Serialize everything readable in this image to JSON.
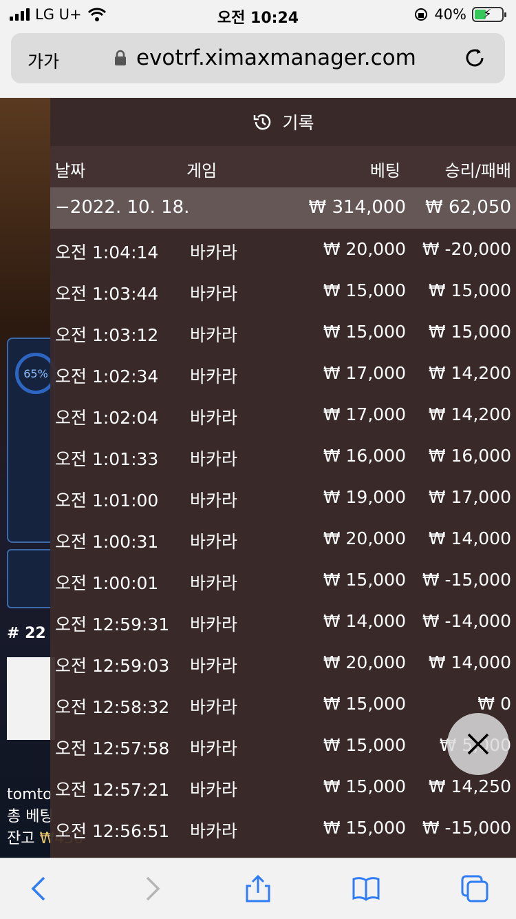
{
  "status": {
    "carrier": "LG U+",
    "time": "오전 10:24",
    "battery": "40%"
  },
  "browser": {
    "aa": "가가",
    "host": "evotrf.ximaxmanager.com"
  },
  "game": {
    "progress_label": "65%",
    "round": "# 22",
    "user_line1": "tomto",
    "user_line2": "총 베팅",
    "user_line3_prefix": "잔고 ",
    "user_line3_amount": "₩450"
  },
  "panel": {
    "title": "기록",
    "columns": {
      "date": "날짜",
      "game": "게임",
      "bet": "베팅",
      "result": "승리/패배"
    },
    "date_group": {
      "date": "−2022. 10. 18.",
      "bet_total": "₩ 314,000",
      "result_total": "₩ 62,050"
    },
    "rows": [
      {
        "time": "오전 1:04:14",
        "game": "바카라",
        "bet": "₩ 20,000",
        "result": "₩ -20,000"
      },
      {
        "time": "오전 1:03:44",
        "game": "바카라",
        "bet": "₩ 15,000",
        "result": "₩ 15,000"
      },
      {
        "time": "오전 1:03:12",
        "game": "바카라",
        "bet": "₩ 15,000",
        "result": "₩ 15,000"
      },
      {
        "time": "오전 1:02:34",
        "game": "바카라",
        "bet": "₩ 17,000",
        "result": "₩ 14,200"
      },
      {
        "time": "오전 1:02:04",
        "game": "바카라",
        "bet": "₩ 17,000",
        "result": "₩ 14,200"
      },
      {
        "time": "오전 1:01:33",
        "game": "바카라",
        "bet": "₩ 16,000",
        "result": "₩ 16,000"
      },
      {
        "time": "오전 1:01:00",
        "game": "바카라",
        "bet": "₩ 19,000",
        "result": "₩ 17,000"
      },
      {
        "time": "오전 1:00:31",
        "game": "바카라",
        "bet": "₩ 20,000",
        "result": "₩ 14,000"
      },
      {
        "time": "오전 1:00:01",
        "game": "바카라",
        "bet": "₩ 15,000",
        "result": "₩ -15,000"
      },
      {
        "time": "오전 12:59:31",
        "game": "바카라",
        "bet": "₩ 14,000",
        "result": "₩ -14,000"
      },
      {
        "time": "오전 12:59:03",
        "game": "바카라",
        "bet": "₩ 20,000",
        "result": "₩ 14,000"
      },
      {
        "time": "오전 12:58:32",
        "game": "바카라",
        "bet": "₩ 15,000",
        "result": "₩ 0"
      },
      {
        "time": "오전 12:57:58",
        "game": "바카라",
        "bet": "₩ 15,000",
        "result": "₩ 5,000"
      },
      {
        "time": "오전 12:57:21",
        "game": "바카라",
        "bet": "₩ 15,000",
        "result": "₩ 14,250"
      },
      {
        "time": "오전 12:56:51",
        "game": "바카라",
        "bet": "₩ 15,000",
        "result": "₩ -15,000"
      }
    ]
  },
  "icons": {
    "history": "history-icon",
    "close": "close-icon",
    "back": "chevron-left-icon",
    "forward": "chevron-right-icon",
    "share": "share-icon",
    "bookmarks": "book-icon",
    "tabs": "tabs-icon"
  },
  "colors": {
    "accent": "#2f7cf6",
    "panel_bg": "#3a2a2a"
  }
}
